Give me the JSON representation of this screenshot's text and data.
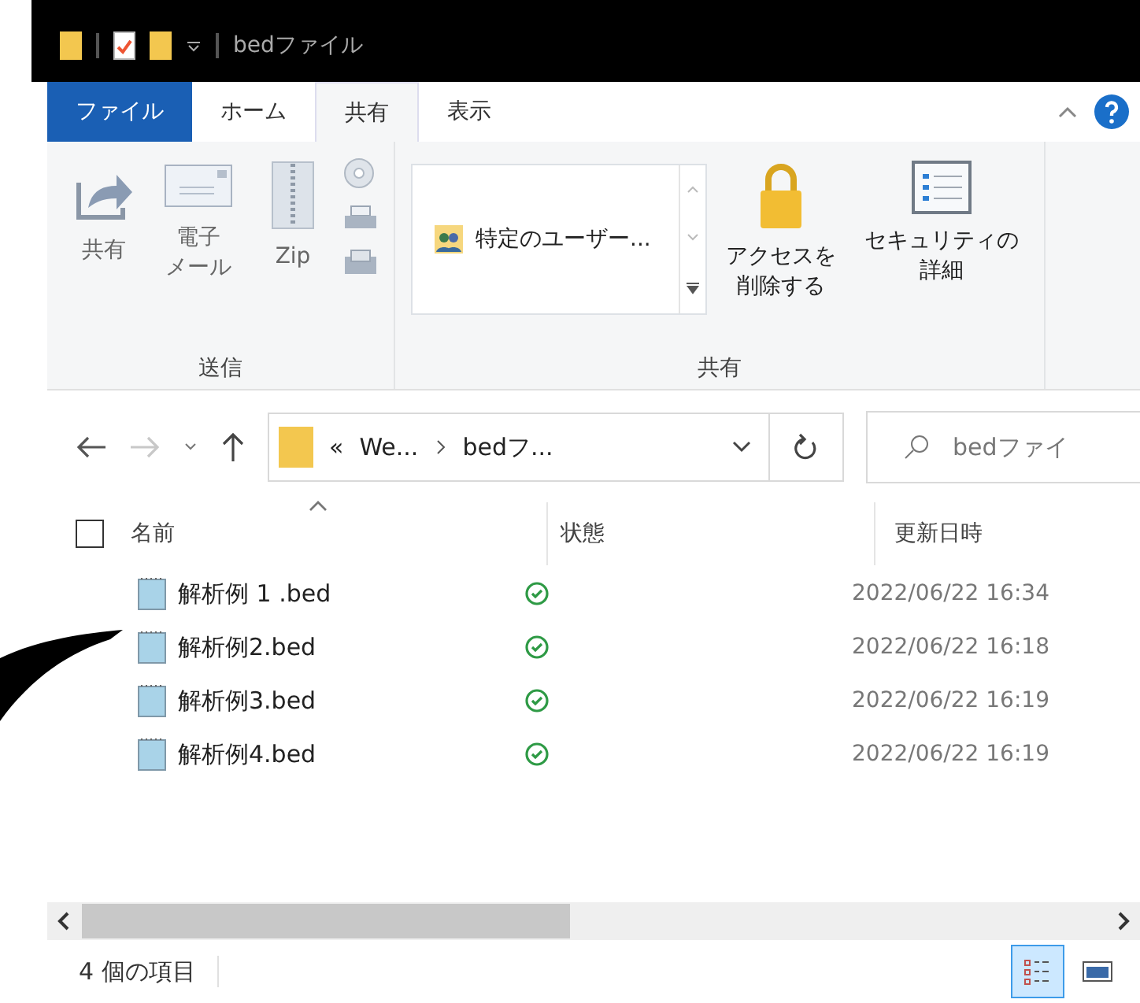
{
  "window": {
    "title": "bedファイル"
  },
  "ribbon_tabs": [
    {
      "label": "ファイル",
      "kind": "file",
      "selected": false
    },
    {
      "label": "ホーム",
      "kind": "tab",
      "selected": false
    },
    {
      "label": "共有",
      "kind": "tab",
      "selected": true
    },
    {
      "label": "表示",
      "kind": "tab",
      "selected": false
    }
  ],
  "ribbon_groups": [
    {
      "label": "送信",
      "buttons": [
        {
          "lines": [
            "共有"
          ],
          "kind": "share"
        },
        {
          "lines": [
            "電子",
            "メール"
          ],
          "kind": "mail"
        },
        {
          "lines": [
            "Zip"
          ],
          "kind": "zip"
        }
      ]
    },
    {
      "label": "共有",
      "share_list": "特定のユーザー...",
      "buttons": [
        {
          "lines": [
            "アクセスを",
            "削除する"
          ],
          "kind": "lock"
        },
        {
          "lines": [
            "セキュリティの",
            "詳細"
          ],
          "kind": "checklist"
        }
      ]
    }
  ],
  "address": {
    "overflow": "«",
    "segments": [
      "We...",
      "bedフ..."
    ]
  },
  "search": {
    "placeholder": "bedファイ"
  },
  "select_all": {
    "checked": false
  },
  "columns": [
    {
      "label": "名前",
      "sorted": true
    },
    {
      "label": "状態",
      "sorted": false
    },
    {
      "label": "更新日時",
      "sorted": false
    }
  ],
  "files": [
    {
      "name": "解析例 1 .bed",
      "synced": true,
      "date": "2022/06/22 16:34"
    },
    {
      "name": "解析例2.bed",
      "synced": true,
      "date": "2022/06/22 16:18"
    },
    {
      "name": "解析例3.bed",
      "synced": true,
      "date": "2022/06/22 16:19"
    },
    {
      "name": "解析例4.bed",
      "synced": true,
      "date": "2022/06/22 16:19"
    }
  ],
  "status_bar": {
    "count": "4 個の項目"
  },
  "view_buttons": [
    {
      "kind": "details",
      "selected": true
    },
    {
      "kind": "large_icons",
      "selected": false
    }
  ]
}
